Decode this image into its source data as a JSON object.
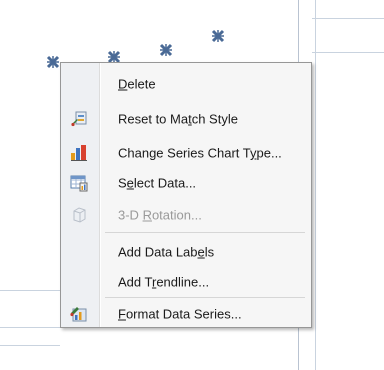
{
  "menu": {
    "items": [
      {
        "label": "Delete",
        "mnemonic": 0,
        "enabled": true,
        "icon": "none"
      },
      {
        "label": "Reset to Match Style",
        "mnemonic": 11,
        "enabled": true,
        "icon": "reset-style-icon"
      },
      {
        "label": "Change Series Chart Type...",
        "mnemonic": 21,
        "enabled": true,
        "icon": "bar-chart-icon"
      },
      {
        "label": "Select Data...",
        "mnemonic": 1,
        "enabled": true,
        "icon": "select-data-icon"
      },
      {
        "label": "3-D Rotation...",
        "mnemonic": 4,
        "enabled": false,
        "icon": "cube-icon"
      },
      {
        "label": "Add Data Labels",
        "mnemonic": 12,
        "enabled": true,
        "icon": "none"
      },
      {
        "label": "Add Trendline...",
        "mnemonic": 5,
        "enabled": true,
        "icon": "none"
      },
      {
        "label": "Format Data Series...",
        "mnemonic": 0,
        "enabled": true,
        "icon": "format-series-icon"
      }
    ]
  },
  "colors": {
    "marker": "#4a6a96",
    "menu_bg": "#f6f6f6",
    "disabled_text": "#9a9a9a"
  }
}
